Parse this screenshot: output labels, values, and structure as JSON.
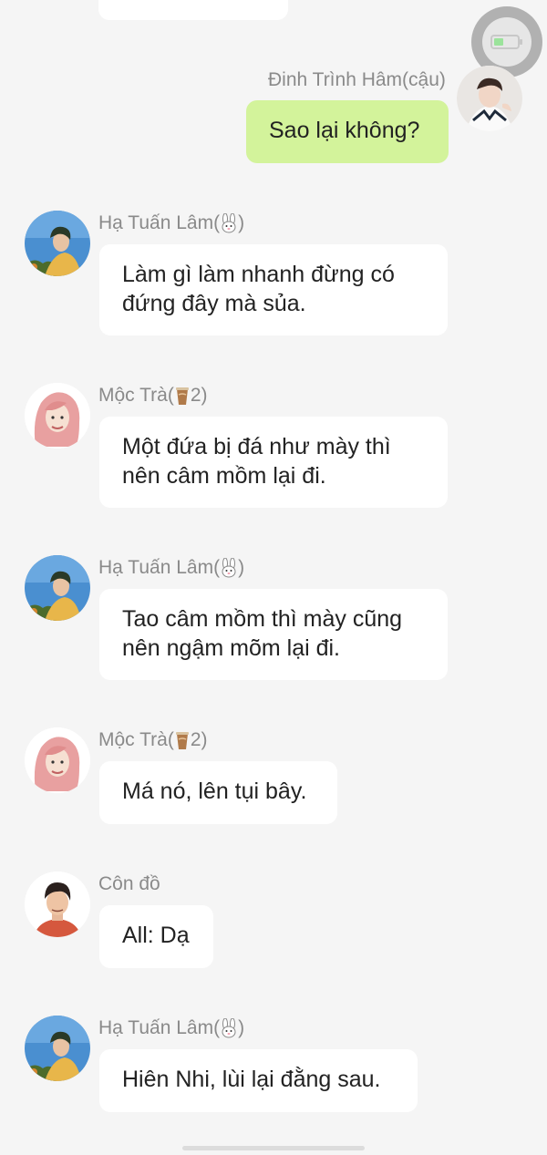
{
  "colors": {
    "background": "#f5f5f5",
    "own_bubble": "#d3f39b",
    "other_bubble": "#ffffff",
    "name_text": "#8a8a8a"
  },
  "messages": [
    {
      "sender": "Đinh Trình Hâm(cậu)",
      "text": "Sao lại không?",
      "own": true
    },
    {
      "sender": "Hạ Tuấn Lâm(",
      "suffix": ")",
      "emoji": "rabbit-icon",
      "text": "Làm gì làm nhanh đừng có đứng đây mà sủa.",
      "own": false
    },
    {
      "sender": "Mộc Trà(",
      "suffix": "2)",
      "emoji": "tea-cup-icon",
      "text": "Một đứa bị đá như mày thì nên câm mồm lại đi.",
      "own": false
    },
    {
      "sender": "Hạ Tuấn Lâm(",
      "suffix": ")",
      "emoji": "rabbit-icon",
      "text": "Tao câm mồm thì mày cũng nên ngậm mõm lại đi.",
      "own": false
    },
    {
      "sender": "Mộc Trà(",
      "suffix": "2)",
      "emoji": "tea-cup-icon",
      "text": "Má nó, lên tụi bây.",
      "own": false
    },
    {
      "sender": "Côn đồ",
      "text": "All: Dạ",
      "own": false
    },
    {
      "sender": "Hạ Tuấn Lâm(",
      "suffix": ")",
      "emoji": "rabbit-icon",
      "text": "Hiên Nhi, lùi lại đằng sau.",
      "own": false
    }
  ]
}
